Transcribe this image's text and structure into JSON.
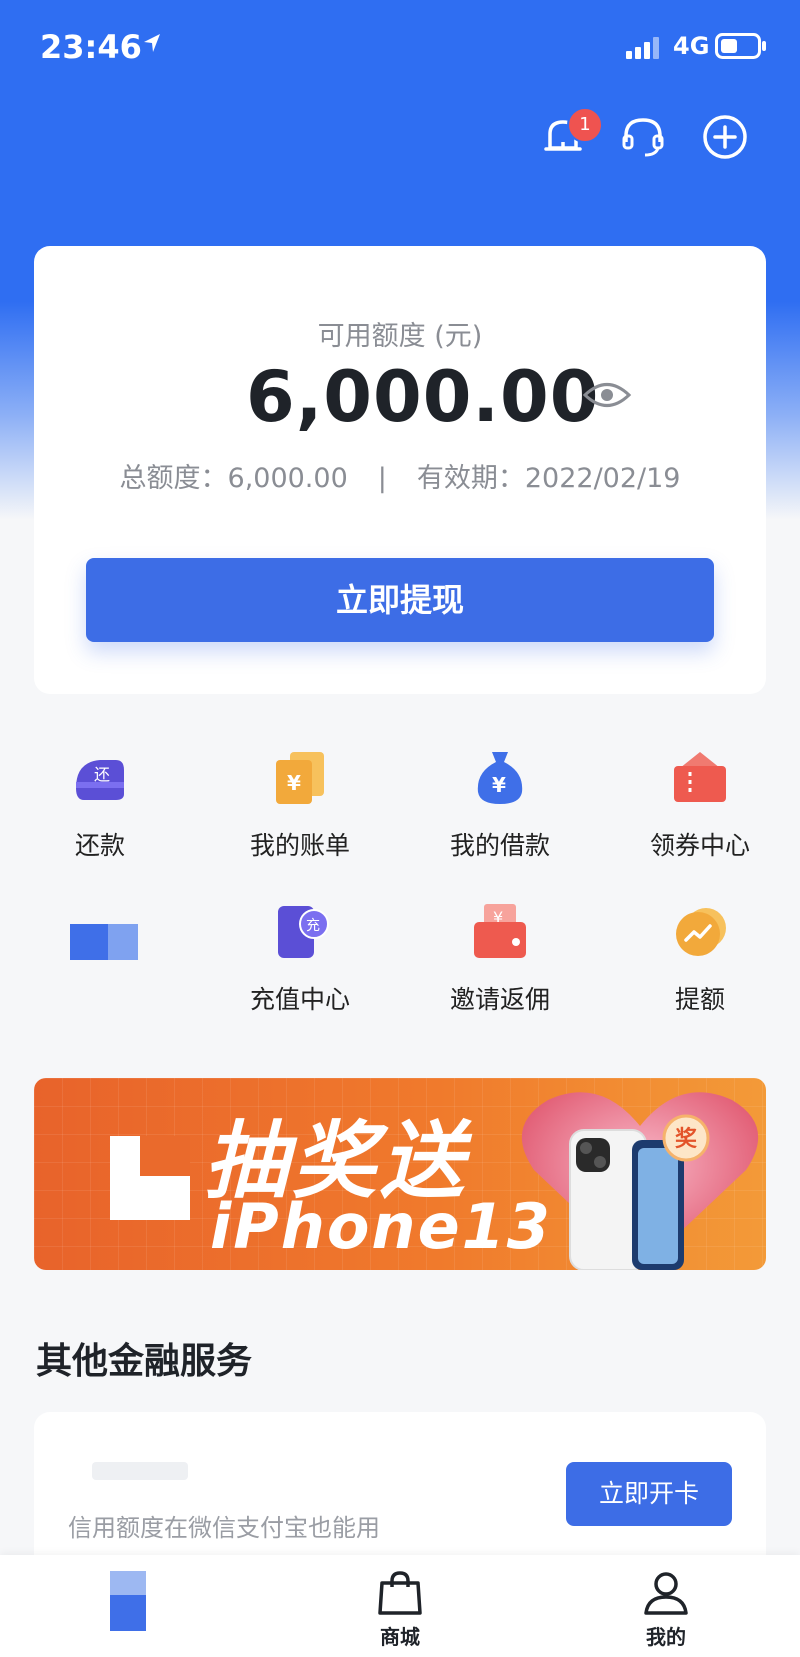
{
  "status_bar": {
    "time": "23:46",
    "network": "4G"
  },
  "header": {
    "notification_badge": "1"
  },
  "credit_card": {
    "available_label": "可用额度 (元)",
    "amount": "6,000.00",
    "total_label": "总额度：6,000.00",
    "separator": "|",
    "valid_label": "有效期：2022/02/19",
    "withdraw_button": "立即提现"
  },
  "quick_actions": [
    {
      "label": "还款",
      "icon": "repay-icon",
      "color": "#5b4fd6",
      "glyph": "还"
    },
    {
      "label": "我的账单",
      "icon": "bill-icon",
      "color": "#f2a93b",
      "glyph": "¥"
    },
    {
      "label": "我的借款",
      "icon": "money-bag-icon",
      "color": "#3f6fe8",
      "glyph": "¥"
    },
    {
      "label": "领券中心",
      "icon": "coupon-icon",
      "color": "#ee5a4f",
      "glyph": ""
    },
    {
      "label": "",
      "icon": "redacted-icon",
      "color": "#3f6fe8",
      "glyph": ""
    },
    {
      "label": "充值中心",
      "icon": "recharge-icon",
      "color": "#5b4fd6",
      "glyph": "充"
    },
    {
      "label": "邀请返佣",
      "icon": "invite-icon",
      "color": "#ee5a4f",
      "glyph": "¥"
    },
    {
      "label": "提额",
      "icon": "raise-limit-icon",
      "color": "#f2a93b",
      "glyph": ""
    }
  ],
  "banner": {
    "title": "抽奖送",
    "subtitle": "iPhone13",
    "prize_badge": "奖"
  },
  "other_services": {
    "title": "其他金融服务",
    "description": "信用额度在微信支付宝也能用",
    "button": "立即开卡"
  },
  "tabbar": {
    "items": [
      {
        "label": ""
      },
      {
        "label": "商城"
      },
      {
        "label": "我的"
      }
    ]
  }
}
